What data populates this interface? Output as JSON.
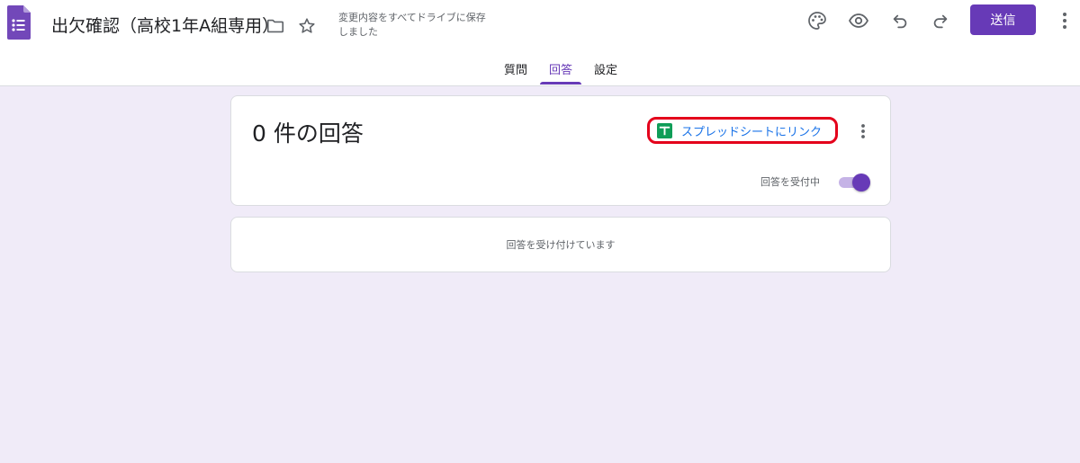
{
  "header": {
    "title": "出欠確認（高校1年A組専用）",
    "save_status": "変更内容をすべてドライブに保存しました",
    "send_label": "送信",
    "icons": {
      "app": "google-forms-icon",
      "folder": "folder-icon",
      "star": "star-icon",
      "palette": "palette-icon",
      "preview": "eye-icon",
      "undo": "undo-icon",
      "redo": "redo-icon",
      "more": "more-vert-icon"
    }
  },
  "tabs": [
    {
      "label": "質問",
      "active": false
    },
    {
      "label": "回答",
      "active": true
    },
    {
      "label": "設定",
      "active": false
    }
  ],
  "summary": {
    "count_text": "0 件の回答",
    "sheet_link_label": "スプレッドシートにリンク",
    "accepting_label": "回答を受付中",
    "accepting": true
  },
  "status": {
    "message": "回答を受け付けています"
  },
  "colors": {
    "accent": "#673ab7",
    "background": "#f0ebf8",
    "link": "#1a73e8",
    "highlight": "#e4001b",
    "sheets_green": "#0f9d58"
  }
}
